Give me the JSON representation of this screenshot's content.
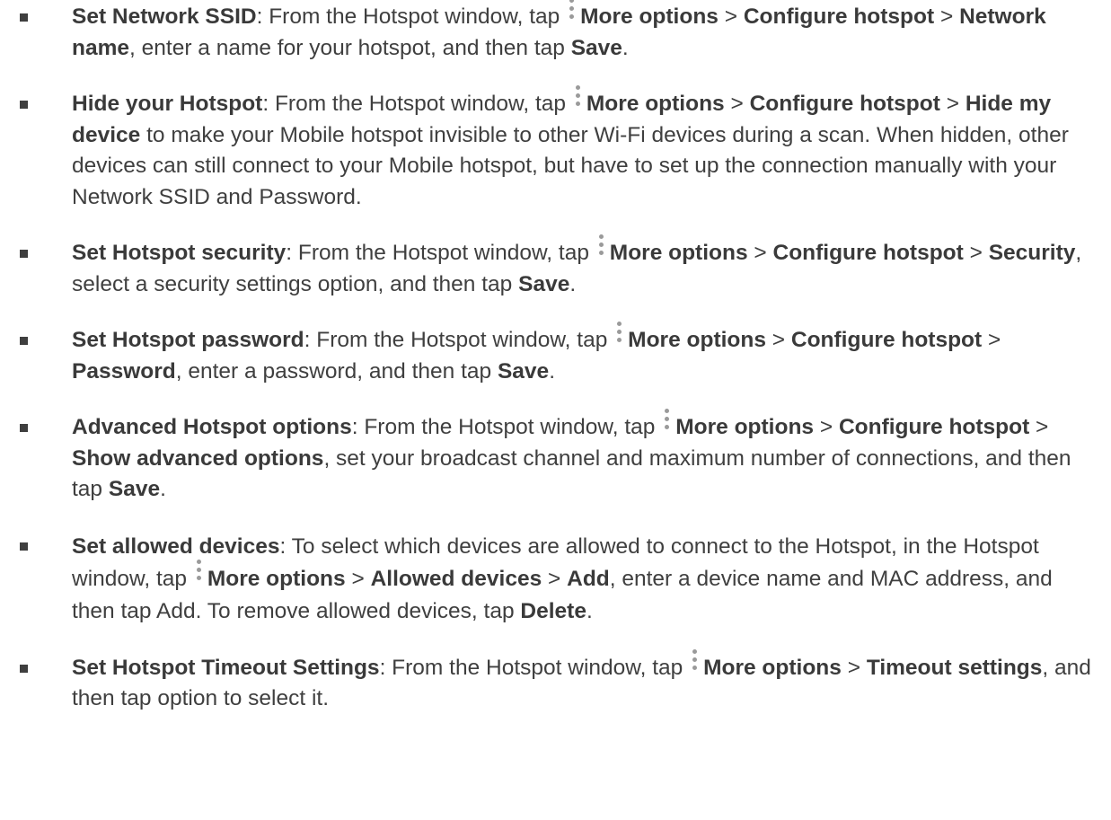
{
  "items": [
    {
      "title": "Set Network SSID",
      "s1": ": From the Hotspot window, tap ",
      "more_options": "More options",
      "sep1": " > ",
      "configure": "Configure hotspot",
      "sep2": " > ",
      "target": "Network name",
      "rest": ", enter a name for your hotspot, and then tap ",
      "save": "Save",
      "end": "."
    },
    {
      "title": "Hide your Hotspot",
      "s1": ": From the Hotspot window, tap ",
      "more_options": "More options",
      "sep1": " > ",
      "configure": "Configure hotspot",
      "sep2": " > ",
      "target": "Hide my device",
      "rest": " to make your Mobile hotspot invisible to other Wi-Fi devices during a scan. When hidden, other devices can still connect to your Mobile hotspot, but have to set up the connection manually with your Network SSID and Password."
    },
    {
      "title": "Set Hotspot security",
      "s1": ": From the Hotspot window, tap ",
      "more_options": "More options",
      "sep1": " > ",
      "configure": "Configure hotspot",
      "sep2": " > ",
      "target": "Security",
      "rest": ", select a security settings option, and then tap ",
      "save": "Save",
      "end": "."
    },
    {
      "title": "Set Hotspot password",
      "s1": ": From the Hotspot window, tap ",
      "more_options": "More options",
      "sep1": " > ",
      "configure": "Configure hotspot",
      "sep2": " > ",
      "target": "Password",
      "rest": ", enter a password, and then tap ",
      "save": "Save",
      "end": "."
    },
    {
      "title": "Advanced Hotspot options",
      "s1": ": From the Hotspot window, tap ",
      "more_options": "More options",
      "sep1": " > ",
      "configure": "Configure hotspot",
      "sep2": " > ",
      "target": "Show advanced options",
      "rest": ", set your broadcast channel and maximum number of connections, and then tap ",
      "save": "Save",
      "end": "."
    },
    {
      "title": "Set allowed devices",
      "s1": ": To select which devices are allowed to connect to the Hotspot, in the Hotspot window, tap ",
      "more_options": "More options",
      "sep1": " > ",
      "allowed": "Allowed devices",
      "sep2": " > ",
      "add": "Add",
      "rest": ", enter a device name and MAC address, and then tap Add. To remove allowed devices, tap ",
      "delete": "Delete",
      "end": "."
    },
    {
      "title": "Set Hotspot Timeout Settings",
      "s1": ": From the Hotspot window, tap ",
      "more_options": "More options",
      "sep1": " > ",
      "timeout": "Timeout settings",
      "rest": ", and then tap option to select it."
    }
  ]
}
